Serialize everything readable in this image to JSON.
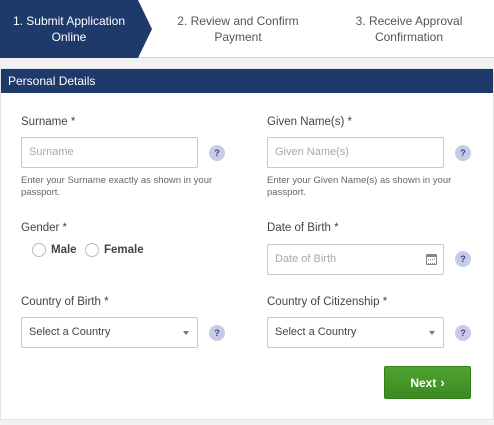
{
  "steps": [
    {
      "line1": "1. Submit Application",
      "line2": "Online"
    },
    {
      "line1": "2. Review and Confirm",
      "line2": "Payment"
    },
    {
      "line1": "3. Receive Approval",
      "line2": "Confirmation"
    }
  ],
  "panel": {
    "title": "Personal Details"
  },
  "surname": {
    "label": "Surname *",
    "placeholder": "Surname",
    "help_line1": "Enter your Surname exactly as shown in your",
    "help_line2": "passport."
  },
  "given_names": {
    "label": "Given Name(s) *",
    "placeholder": "Given Name(s)",
    "help_line1": "Enter your Given Name(s) as shown in your",
    "help_line2": "passport."
  },
  "gender": {
    "label": "Gender *",
    "options": [
      "Male",
      "Female"
    ]
  },
  "dob": {
    "label": "Date of Birth *",
    "placeholder": "Date of Birth"
  },
  "country_of_birth": {
    "label": "Country of Birth *",
    "value": "Select a Country"
  },
  "country_of_citizenship": {
    "label": "Country of Citizenship *",
    "value": "Select a Country"
  },
  "help_symbol": "?",
  "next_button": {
    "label": "Next",
    "icon": "chevron-right-icon",
    "color": "#449427"
  },
  "colors": {
    "brand": "#1e3a6b",
    "help_badge": "#c7cbe8"
  }
}
